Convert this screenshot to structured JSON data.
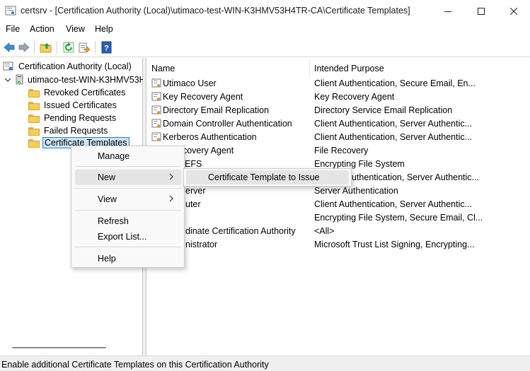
{
  "window": {
    "title": "certsrv - [Certification Authority (Local)\\utimaco-test-WIN-K3HMV53H4TR-CA\\Certificate Templates]",
    "app_icon": "certsrv-app-icon",
    "controls": [
      "minimize-icon",
      "maximize-icon",
      "close-icon"
    ]
  },
  "menubar": {
    "items": [
      "File",
      "Action",
      "View",
      "Help"
    ]
  },
  "toolbar": {
    "buttons": [
      "back-arrow-icon",
      "forward-arrow-icon",
      "up-folder-icon",
      "refresh-icon",
      "export-list-icon",
      "help-icon"
    ]
  },
  "tree": {
    "root": "Certification Authority (Local)",
    "ca": "utimaco-test-WIN-K3HMV53H",
    "folders": [
      "Revoked Certificates",
      "Issued Certificates",
      "Pending Requests",
      "Failed Requests",
      "Certificate Templates"
    ],
    "selected": "Certificate Templates"
  },
  "list": {
    "columns": [
      "Name",
      "Intended Purpose"
    ],
    "rows": [
      {
        "name": "Utimaco User",
        "purpose": "Client Authentication, Secure Email, En..."
      },
      {
        "name": "Key Recovery Agent",
        "purpose": "Key Recovery Agent"
      },
      {
        "name": "Directory Email Replication",
        "purpose": "Directory Service Email Replication"
      },
      {
        "name": "Domain Controller Authentication",
        "purpose": "Client Authentication, Server Authentic..."
      },
      {
        "name": "Kerberos Authentication",
        "purpose": "Client Authentication, Server Authentic..."
      },
      {
        "name": "ecovery Agent",
        "purpose": "File Recovery"
      },
      {
        "name": "EFS",
        "purpose": "Encrypting File System"
      },
      {
        "name": "",
        "purpose": "uthentication, Server Authentic..."
      },
      {
        "name": "erver",
        "purpose": "Server Authentication"
      },
      {
        "name": "uter",
        "purpose": "Client Authentication, Server Authentic..."
      },
      {
        "name": "",
        "purpose": "Encrypting File System, Secure Email, Cl..."
      },
      {
        "name": "dinate Certification Authority",
        "purpose": "<All>"
      },
      {
        "name": "nistrator",
        "purpose": "Microsoft Trust List Signing, Encrypting..."
      }
    ]
  },
  "context_menu": {
    "items": [
      "Manage",
      "New",
      "View",
      "Refresh",
      "Export List...",
      "Help"
    ],
    "submenu_item": "Certificate Template to Issue"
  },
  "status": {
    "text": "Enable additional Certificate Templates on this Certification Authority"
  }
}
